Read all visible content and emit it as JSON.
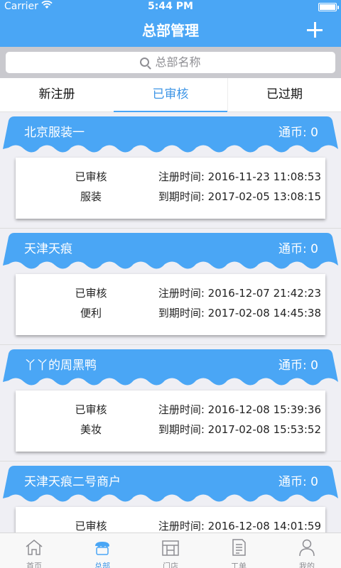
{
  "status_bar": {
    "carrier": "Carrier",
    "time": "5:44 PM"
  },
  "nav": {
    "title": "总部管理",
    "add_icon": "plus-icon"
  },
  "search": {
    "placeholder": "总部名称",
    "icon": "search-icon"
  },
  "tabs": [
    {
      "label": "新注册",
      "active": false
    },
    {
      "label": "已审核",
      "active": true
    },
    {
      "label": "已过期",
      "active": false
    }
  ],
  "stores": [
    {
      "name": "北京服装一",
      "coins": "通币: 0",
      "status": "已审核",
      "category": "服装",
      "reg_time": "注册时间: 2016-11-23 11:08:53",
      "exp_time": "到期时间: 2017-02-05 13:08:15"
    },
    {
      "name": "天津天痕",
      "coins": "通币: 0",
      "status": "已审核",
      "category": "便利",
      "reg_time": "注册时间: 2016-12-07 21:42:23",
      "exp_time": "到期时间: 2017-02-08 14:45:38"
    },
    {
      "name": "丫丫的周黑鸭",
      "coins": "通币: 0",
      "status": "已审核",
      "category": "美妆",
      "reg_time": "注册时间: 2016-12-08 15:39:36",
      "exp_time": "到期时间: 2017-02-08 15:53:52"
    },
    {
      "name": "天津天痕二号商户",
      "coins": "通币: 0",
      "status": "已审核",
      "category": "",
      "reg_time": "注册时间: 2016-12-08 14:01:59",
      "exp_time": ""
    }
  ],
  "tabbar": [
    {
      "label": "首页",
      "icon": "home-icon",
      "active": false
    },
    {
      "label": "总部",
      "icon": "store-icon",
      "active": true
    },
    {
      "label": "门店",
      "icon": "shop-front-icon",
      "active": false
    },
    {
      "label": "工单",
      "icon": "document-icon",
      "active": false
    },
    {
      "label": "我的",
      "icon": "person-icon",
      "active": false
    }
  ],
  "colors": {
    "primary": "#4aa6f5",
    "active_text": "#3d95e6",
    "background": "#efeff4"
  }
}
